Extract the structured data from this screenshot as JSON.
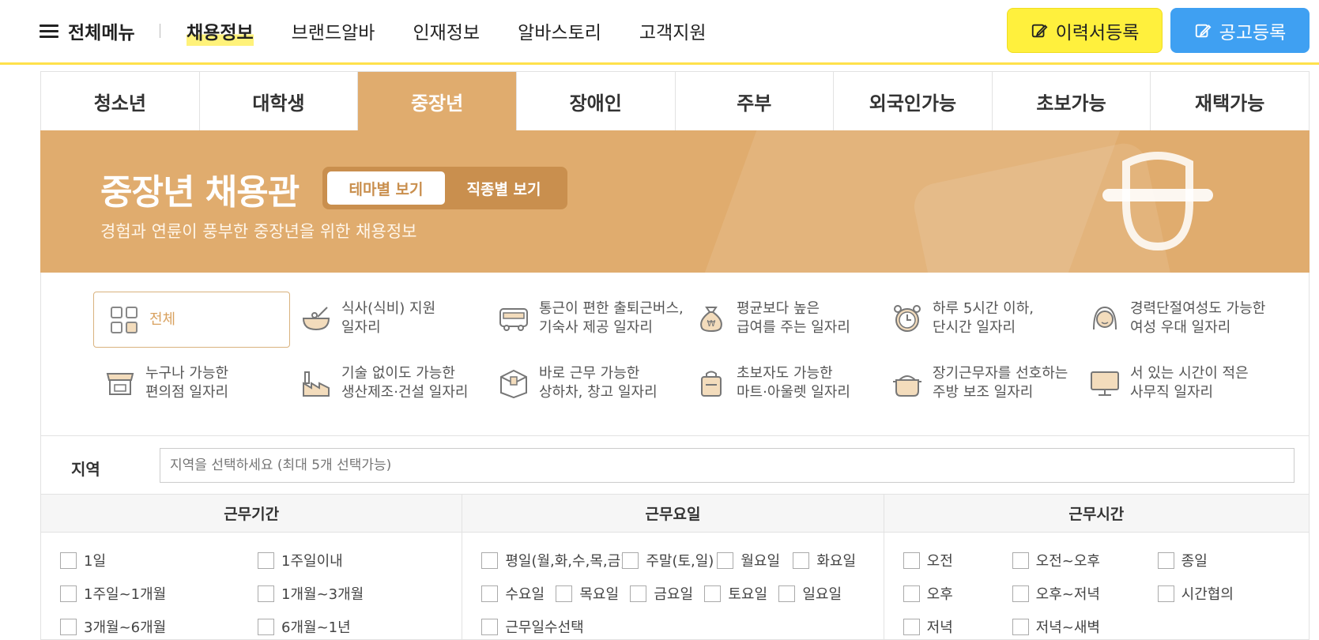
{
  "header": {
    "menu_label": "전체메뉴",
    "nav": [
      "채용정보",
      "브랜드알바",
      "인재정보",
      "알바스토리",
      "고객지원"
    ],
    "active_nav": "채용정보",
    "resume_button": "이력서등록",
    "post_button": "공고등록"
  },
  "tabs": {
    "items": [
      "청소년",
      "대학생",
      "중장년",
      "장애인",
      "주부",
      "외국인가능",
      "초보가능",
      "재택가능"
    ],
    "active": "중장년"
  },
  "banner": {
    "title": "중장년 채용관",
    "subtitle": "경험과 연륜이 풍부한 중장년을 위한 채용정보",
    "toggle_theme": "테마별 보기",
    "toggle_job": "직종별 보기",
    "active_toggle": "테마별 보기"
  },
  "categories": {
    "all": "전체",
    "items": [
      {
        "icon": "bowl-icon",
        "text": "식사(식비) 지원\n일자리"
      },
      {
        "icon": "bus-icon",
        "text": "통근이 편한 출퇴근버스,\n기숙사 제공 일자리"
      },
      {
        "icon": "money-bag-icon",
        "text": "평균보다 높은\n급여를 주는 일자리"
      },
      {
        "icon": "alarm-clock-icon",
        "text": "하루 5시간 이하,\n단시간 일자리"
      },
      {
        "icon": "woman-icon",
        "text": "경력단절여성도 가능한\n여성 우대 일자리"
      },
      {
        "icon": "store-icon",
        "text": "누구나 가능한\n편의점 일자리"
      },
      {
        "icon": "factory-icon",
        "text": "기술 없이도 가능한\n생산제조·건설 일자리"
      },
      {
        "icon": "box-icon",
        "text": "바로 근무 가능한\n상하차, 창고 일자리"
      },
      {
        "icon": "cart-bag-icon",
        "text": "초보자도 가능한\n마트·아울렛 일자리"
      },
      {
        "icon": "pot-icon",
        "text": "장기근무자를 선호하는\n주방 보조 일자리"
      },
      {
        "icon": "monitor-icon",
        "text": "서 있는 시간이 적은\n사무직 일자리"
      }
    ]
  },
  "region": {
    "label": "지역",
    "placeholder": "지역을 선택하세요 (최대 5개 선택가능)"
  },
  "filters": {
    "period": {
      "title": "근무기간",
      "options": [
        "1일",
        "1주일이내",
        "1주일~1개월",
        "1개월~3개월",
        "3개월~6개월",
        "6개월~1년"
      ]
    },
    "days": {
      "title": "근무요일",
      "options": [
        "평일(월,화,수,목,금)",
        "주말(토,일)",
        "월요일",
        "화요일",
        "수요일",
        "목요일",
        "금요일",
        "토요일",
        "일요일",
        "근무일수선택"
      ]
    },
    "hours": {
      "title": "근무시간",
      "options": [
        "오전",
        "오전~오후",
        "종일",
        "오후",
        "오후~저녁",
        "시간협의",
        "저녁",
        "저녁~새벽"
      ]
    }
  },
  "colors": {
    "accent": "#e0ac6e",
    "header_line": "#ffe14b",
    "resume_btn": "#fff03d",
    "post_btn": "#3fa0f2"
  }
}
